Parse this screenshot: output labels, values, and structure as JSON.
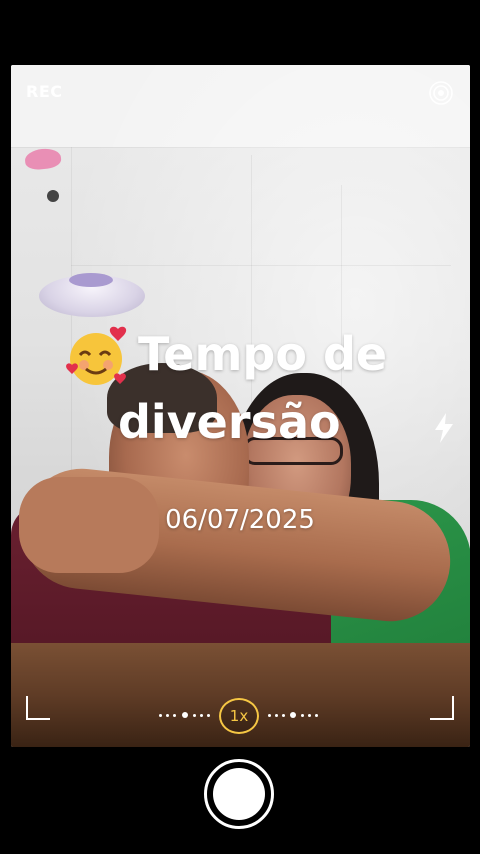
{
  "status": {
    "rec_label": "REC"
  },
  "overlay": {
    "emoji": "smiling-face-with-hearts",
    "title_line1": "Tempo de",
    "title_line2": "diversão",
    "date": "06/07/2025"
  },
  "controls": {
    "zoom_label": "1x",
    "accent_color": "#f6c744",
    "icons": [
      "target-icon",
      "flash-icon",
      "shutter-button"
    ]
  }
}
